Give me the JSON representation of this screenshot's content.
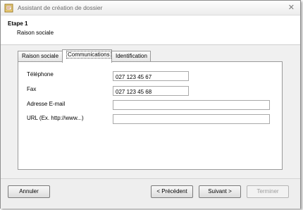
{
  "window": {
    "title": "Assistant de création de dossier",
    "close_glyph": "✕"
  },
  "header": {
    "step": "Etape 1",
    "substep": "Raison sociale"
  },
  "tabs": [
    {
      "label": "Raison sociale",
      "active": false
    },
    {
      "label": "Communications",
      "active": true
    },
    {
      "label": "Identification",
      "active": false
    }
  ],
  "form": {
    "phone_label": "Téléphone",
    "phone_value": "027 123 45 67",
    "fax_label": "Fax",
    "fax_value": "027 123 45 68",
    "email_label": "Adresse E-mail",
    "email_value": "",
    "url_label": "URL (Ex. http://www...)",
    "url_value": ""
  },
  "footer": {
    "cancel_label": "Annuler",
    "prev_label": "< Précédent",
    "next_label": "Suivant >",
    "finish_label": "Terminer"
  }
}
